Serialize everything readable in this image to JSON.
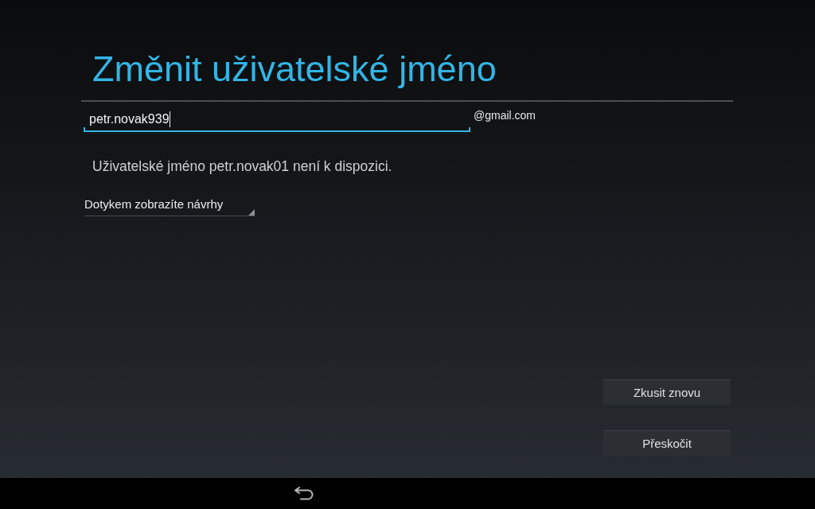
{
  "title": "Změnit uživatelské jméno",
  "username_field": {
    "value": "petr.novak939",
    "focused": true
  },
  "domain_suffix": "@gmail.com",
  "message": "Uživatelské jméno petr.novak01 není k dispozici.",
  "suggestions_spinner": {
    "label": "Dotykem zobrazíte návrhy"
  },
  "buttons": [
    {
      "label": "Zkusit znovu"
    },
    {
      "label": "Přeskočit"
    }
  ]
}
